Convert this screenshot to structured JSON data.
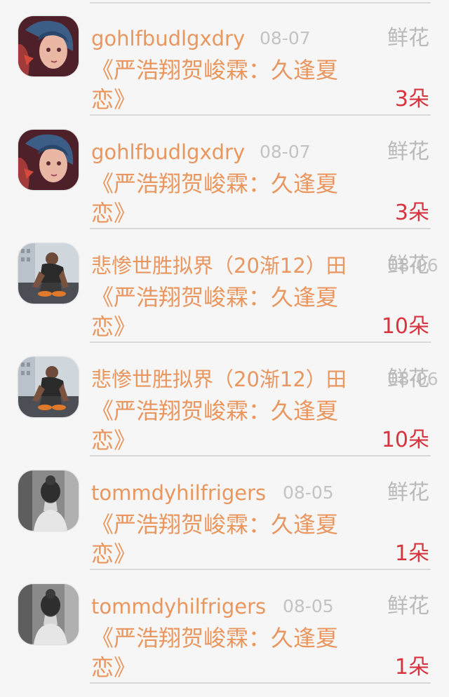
{
  "items": [
    {
      "username": "gohlfbudlgxdry",
      "date": "08-07",
      "kind": "鲜花",
      "book": "《严浩翔贺峻霖：久逢夏恋》",
      "count": "3朵",
      "avatar_icon": "anime-girl-avatar-icon"
    },
    {
      "username": "gohlfbudlgxdry",
      "date": "08-07",
      "kind": "鲜花",
      "book": "《严浩翔贺峻霖：久逢夏恋》",
      "count": "3朵",
      "avatar_icon": "anime-girl-avatar-icon"
    },
    {
      "username": "悲惨世胜拟界（20渐12）田",
      "date": "08-06",
      "kind": "鲜花",
      "book": "《严浩翔贺峻霖：久逢夏恋》",
      "count": "10朵",
      "avatar_icon": "man-tying-shoe-avatar-icon"
    },
    {
      "username": "悲惨世胜拟界（20渐12）田",
      "date": "08-06",
      "kind": "鲜花",
      "book": "《严浩翔贺峻霖：久逢夏恋》",
      "count": "10朵",
      "avatar_icon": "man-tying-shoe-avatar-icon"
    },
    {
      "username": "tommdyhilfrigers",
      "date": "08-05",
      "kind": "鲜花",
      "book": "《严浩翔贺峻霖：久逢夏恋》",
      "count": "1朵",
      "avatar_icon": "woman-back-avatar-icon"
    },
    {
      "username": "tommdyhilfrigers",
      "date": "08-05",
      "kind": "鲜花",
      "book": "《严浩翔贺峻霖：久逢夏恋》",
      "count": "1朵",
      "avatar_icon": "woman-back-avatar-icon"
    }
  ],
  "colors": {
    "username": "#e9965f",
    "book": "#e9965f",
    "count": "#d6343f",
    "meta": "#c3c3c3",
    "divider": "#d9d9d9"
  }
}
